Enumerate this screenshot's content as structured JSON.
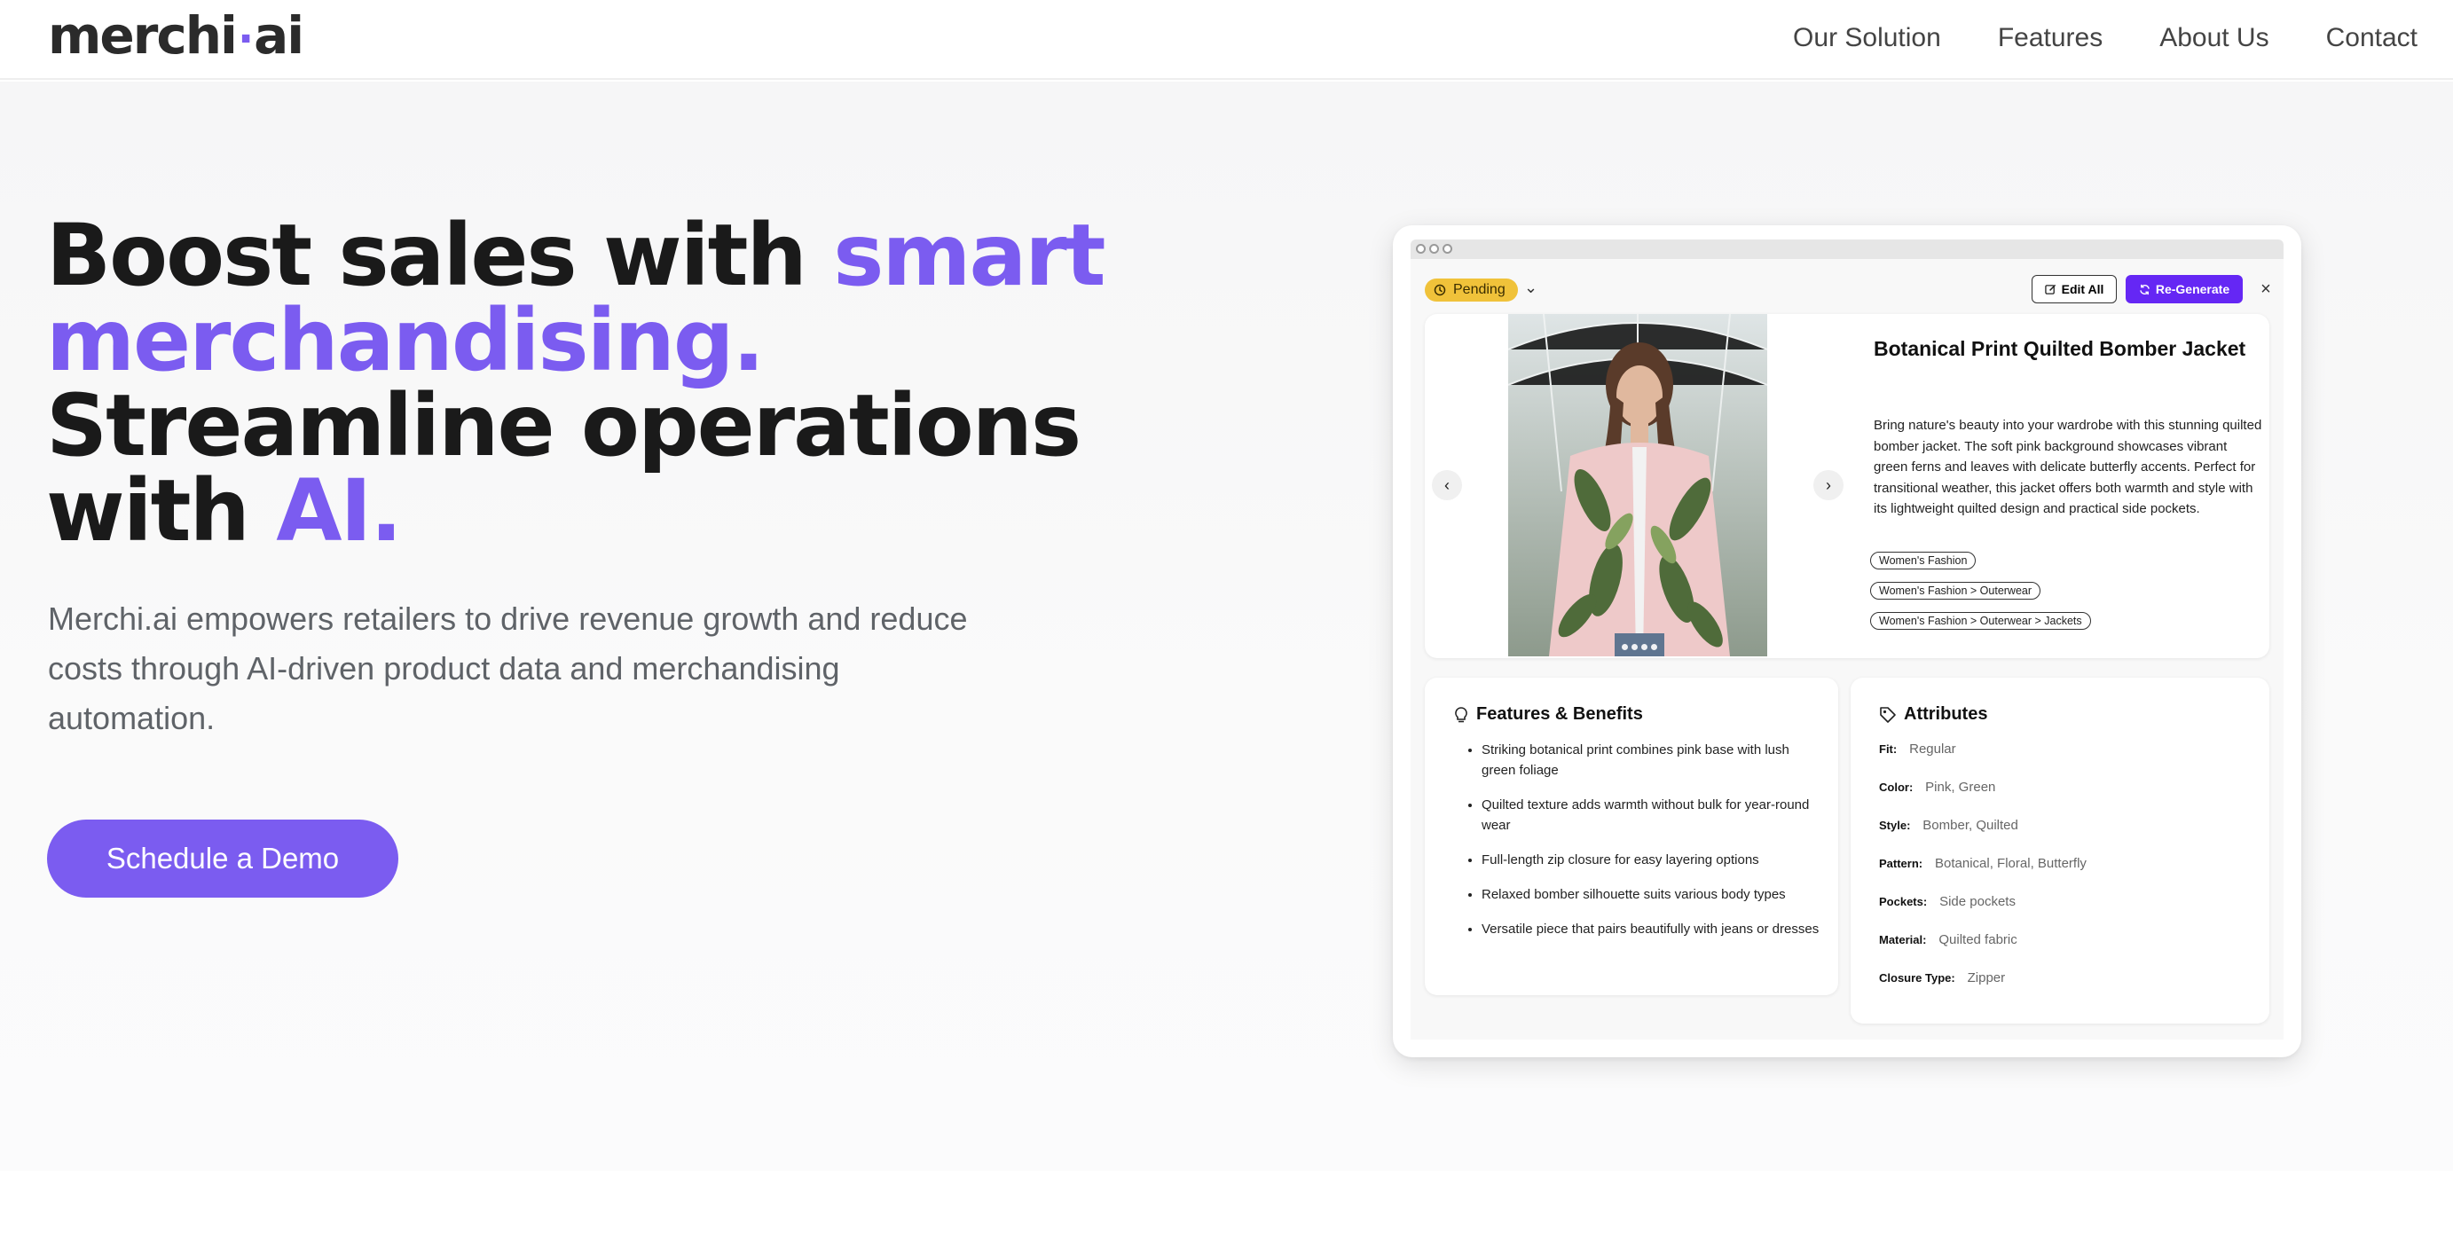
{
  "nav": {
    "logo_main": "merchi",
    "logo_dot": "·",
    "logo_suffix": "ai",
    "links": [
      "Our Solution",
      "Features",
      "About Us",
      "Contact"
    ]
  },
  "hero": {
    "headline_part1": "Boost sales with ",
    "headline_accent1": "smart merchandising.",
    "headline_part2": "Streamline operations with ",
    "headline_accent2": "AI.",
    "subtext": "Merchi.ai empowers retailers to drive revenue growth and reduce costs through AI-driven product data and merchandising automation.",
    "cta_label": "Schedule a Demo"
  },
  "mock": {
    "status_badge": "Pending",
    "edit_all_label": "Edit All",
    "regenerate_label": "Re-Generate",
    "close_symbol": "×",
    "product_title": "Botanical Print Quilted Bomber Jacket",
    "product_description": "Bring nature's beauty into your wardrobe with this stunning quilted bomber jacket. The soft pink background showcases vibrant green ferns and leaves with delicate butterfly accents. Perfect for transitional weather, this jacket offers both warmth and style with its lightweight quilted design and practical side pockets.",
    "tags": [
      "Women's Fashion",
      "Women's Fashion > Outerwear",
      "Women's Fashion > Outerwear > Jackets"
    ],
    "features_title": "Features & Benefits",
    "features": [
      "Striking botanical print combines pink base with lush green foliage",
      "Quilted texture adds warmth without bulk for year-round wear",
      "Full-length zip closure for easy layering options",
      "Relaxed bomber silhouette suits various body types",
      "Versatile piece that pairs beautifully with jeans or dresses"
    ],
    "attributes_title": "Attributes",
    "attributes": [
      {
        "label": "Fit:",
        "value": "Regular"
      },
      {
        "label": "Color:",
        "value": "Pink, Green"
      },
      {
        "label": "Style:",
        "value": "Bomber, Quilted"
      },
      {
        "label": "Pattern:",
        "value": "Botanical, Floral, Butterfly"
      },
      {
        "label": "Pockets:",
        "value": "Side pockets"
      },
      {
        "label": "Material:",
        "value": "Quilted fabric"
      },
      {
        "label": "Closure Type:",
        "value": "Zipper"
      }
    ],
    "colors": {
      "accent": "#7b5cf0",
      "regen": "#6527f4",
      "pending": "#f0c23a"
    }
  }
}
